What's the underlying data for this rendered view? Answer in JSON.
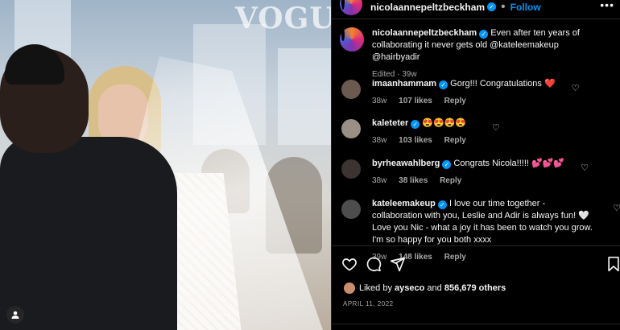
{
  "photo": {
    "watermark": "VOGUE"
  },
  "post": {
    "author": "nicolaannepeltzbeckham",
    "follow_label": "Follow",
    "separator": "•",
    "caption_text": "Even after ten years of collaborating it never gets old @kateleemakeup @hairbyadir",
    "caption_meta": "Edited · 39w"
  },
  "comments": [
    {
      "user": "imaanhammam",
      "text": "Gorg!!! Congratulations ❤️",
      "age": "38w",
      "likes": "107 likes",
      "reply": "Reply",
      "avatar_color": "#6b5a4f"
    },
    {
      "user": "kaleteter",
      "text": "😍😍😍😍",
      "age": "38w",
      "likes": "103 likes",
      "reply": "Reply",
      "avatar_color": "#9a8f85"
    },
    {
      "user": "byrheawahlberg",
      "text": "Congrats Nicola!!!!! 💕💕💕",
      "age": "38w",
      "likes": "38 likes",
      "reply": "Reply",
      "avatar_color": "#3b3430"
    },
    {
      "user": "kateleemakeup",
      "text": "I love our time together - collaboration with you, Leslie and Adir is always fun! 🤍 Love you Nic - what a joy it has been to watch you grow. I'm so happy for you both xxxx",
      "age": "39w",
      "likes": "148 likes",
      "reply": "Reply",
      "avatar_color": "#4d4d4d"
    }
  ],
  "likes_summary": {
    "prefix": "Liked by",
    "user": "ayseco",
    "joiner": "and",
    "others": "856,679 others"
  },
  "date": "APRIL 11, 2022",
  "colors": {
    "accent": "#0095f6",
    "background": "#000000",
    "muted": "#a8a8a8"
  }
}
